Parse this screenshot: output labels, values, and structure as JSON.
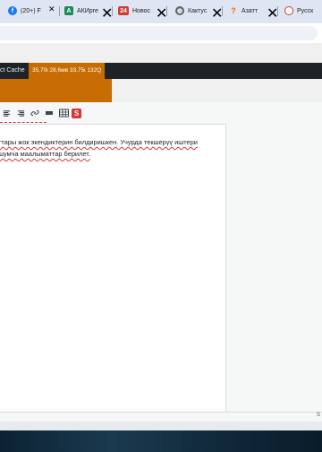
{
  "browser": {
    "tabs": [
      {
        "favicon": "facebook-icon",
        "color": "#1877f2",
        "glyph": "f",
        "title": "(20+) F"
      },
      {
        "favicon": "akipress-logo-icon",
        "color": "#1a8a5a",
        "glyph": "A",
        "title": "АКИpre"
      },
      {
        "favicon": "news-logo-icon",
        "color": "#d33b2c",
        "glyph": "24",
        "title": "Новос"
      },
      {
        "favicon": "globe-icon",
        "color": "#5f6368",
        "glyph": "●",
        "title": "Кактус"
      },
      {
        "favicon": "question-icon",
        "color": "#e8710a",
        "glyph": "?",
        "title": "Азатт"
      },
      {
        "favicon": "russian-site-icon",
        "color": "#d33b2c",
        "glyph": "○",
        "title": "Русск"
      }
    ],
    "close_glyph": "✕"
  },
  "adminbar": {
    "cache_label": "ct Cache",
    "cache_stats": "35,70ɩ 28,6мв 33,75ɩ 132Q"
  },
  "editor": {
    "toolbar_icons": [
      "align-justify-icon",
      "align-right-icon",
      "link-icon",
      "horizontal-rule-icon",
      "table-icon",
      "spellcheck-s-icon"
    ],
    "toolbar_glyphs": [
      "≡",
      "≡",
      "🔗",
      "▬",
      "▦",
      "S"
    ],
    "content_lines": [
      "ттары жок экендиктерин билдиришкен. Учурда текшерүү иштери",
      "шумча маалыматтар берилет."
    ],
    "status_text": "S"
  },
  "colors": {
    "admin_bar": "#1d2327",
    "accent_orange": "#c66c02",
    "spellcheck": "#d63638"
  }
}
